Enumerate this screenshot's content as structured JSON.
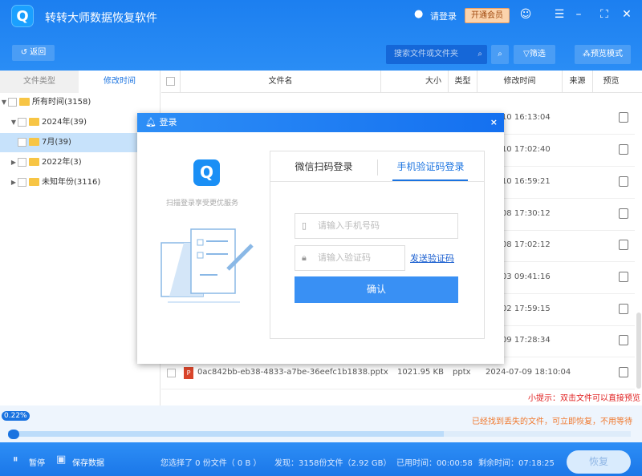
{
  "app": {
    "title": "转转大师数据恢复软件",
    "login": "请登录",
    "vip": "开通会员"
  },
  "toolbar": {
    "back": "返回",
    "search_placeholder": "搜索文件或文件夹",
    "filter": "筛选",
    "preview_mode": "预览模式"
  },
  "left_tabs": [
    "文件类型",
    "修改时间"
  ],
  "tree": [
    {
      "label": "所有时间(3158)",
      "arrow": "▼"
    },
    {
      "label": "2024年(39)",
      "arrow": "▼"
    },
    {
      "label": "7月(39)",
      "arrow": ""
    },
    {
      "label": "2022年(3)",
      "arrow": "▶"
    },
    {
      "label": "未知年份(3116)",
      "arrow": "▶"
    }
  ],
  "columns": [
    "文件名",
    "大小",
    "类型",
    "修改时间",
    "来源",
    "预览"
  ],
  "rows": [
    {
      "time": "-07-10 16:13:04"
    },
    {
      "time": "-07-10 17:02:40"
    },
    {
      "time": "-07-10 16:59:21"
    },
    {
      "time": "-07-08 17:30:12"
    },
    {
      "time": "-07-08 17:02:12"
    },
    {
      "time": "-07-03 09:41:16"
    },
    {
      "time": "-07-02 17:59:15"
    },
    {
      "time": "-07-09 17:28:34"
    }
  ],
  "last_row": {
    "name": "0ac842bb-eb38-4833-a7be-36eefc1b1838.pptx",
    "size": "1021.95 KB",
    "type": "pptx",
    "time": "2024-07-09 18:10:04"
  },
  "hint": "小提示：双击文件可以直接预览",
  "progress": {
    "percent_label": "0.22%",
    "value": 0.22,
    "found_msg": "已经找到丢失的文件，可立即恢复，不用等待"
  },
  "bottom": {
    "pause": "暂停",
    "save": "保存数据",
    "selected": "您选择了 0 份文件（ 0 B ）",
    "found": "发现：3158份文件（2.92 GB）",
    "elapsed": "已用时间：00:00:58",
    "remaining": "剩余时间：07:18:25",
    "recover": "恢复"
  },
  "dialog": {
    "title": "登录",
    "subtitle": "扫描登录享受更优服务",
    "tab_wechat": "微信扫码登录",
    "tab_phone": "手机验证码登录",
    "phone_placeholder": "请输入手机号码",
    "code_placeholder": "请输入验证码",
    "send_code": "发送验证码",
    "confirm": "确认"
  }
}
